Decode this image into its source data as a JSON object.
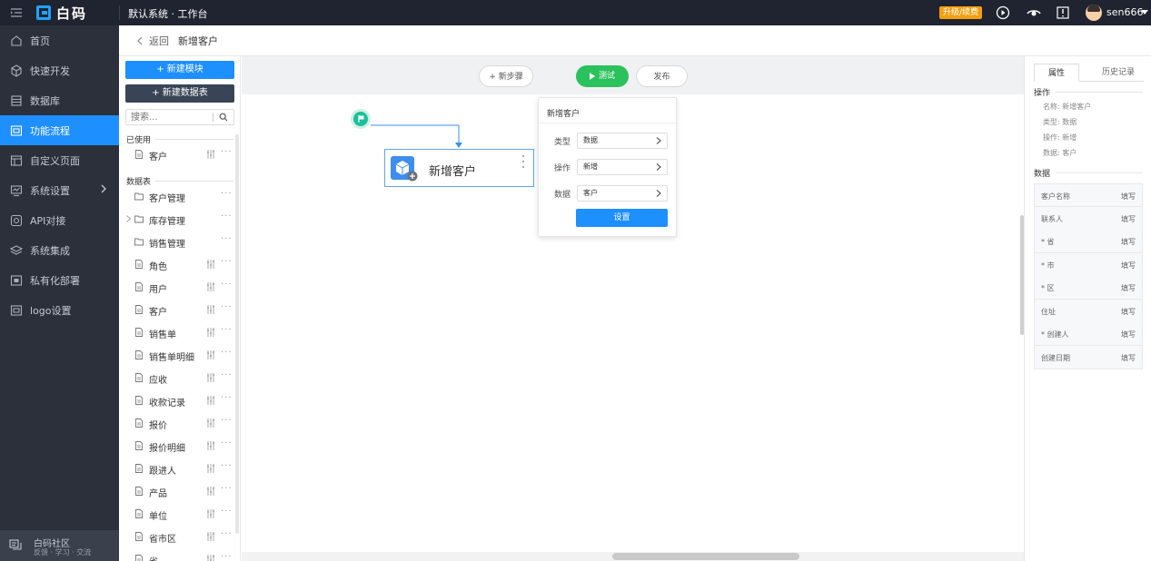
{
  "colors": {
    "topbar": "#1f2430",
    "sidebar": "#2b303b",
    "accent": "#1e8fff",
    "test_green": "#2bc15d",
    "upgrade": "#f4a012",
    "start_node": "#1bbf9c"
  },
  "topbar": {
    "logo_text": "白码",
    "workspace_title": "默认系统 · 工作台",
    "upgrade_label": "升级/续费",
    "username": "sen666"
  },
  "nav": {
    "items": [
      {
        "label": "首页",
        "icon": "home-icon"
      },
      {
        "label": "快速开发",
        "icon": "cube-icon"
      },
      {
        "label": "数据库",
        "icon": "database-icon"
      },
      {
        "label": "功能流程",
        "icon": "flow-icon",
        "active": true
      },
      {
        "label": "自定义页面",
        "icon": "page-icon"
      },
      {
        "label": "系统设置",
        "icon": "monitor-icon",
        "has_arrow": true
      },
      {
        "label": "API对接",
        "icon": "api-icon"
      },
      {
        "label": "系统集成",
        "icon": "layers-icon"
      },
      {
        "label": "私有化部署",
        "icon": "server-icon"
      },
      {
        "label": "logo设置",
        "icon": "logo-icon"
      }
    ],
    "community_title": "白码社区",
    "community_sub": "反馈 · 学习 · 交流"
  },
  "breadcrumb": {
    "back": "返回",
    "page": "新增客户"
  },
  "panel": {
    "new_module": "+ 新建模块",
    "new_table": "+ 新建数据表",
    "search_placeholder": "搜索...",
    "used_label": "已使用",
    "used_items": [
      {
        "label": "客户"
      }
    ],
    "tables_label": "数据表",
    "table_items": [
      {
        "label": "客户管理",
        "type": "folder"
      },
      {
        "label": "库存管理",
        "type": "folder",
        "expandable": true
      },
      {
        "label": "销售管理",
        "type": "folder"
      },
      {
        "label": "角色",
        "type": "table"
      },
      {
        "label": "用户",
        "type": "table"
      },
      {
        "label": "客户",
        "type": "table"
      },
      {
        "label": "销售单",
        "type": "table"
      },
      {
        "label": "销售单明细",
        "type": "table"
      },
      {
        "label": "应收",
        "type": "table"
      },
      {
        "label": "收款记录",
        "type": "table"
      },
      {
        "label": "报价",
        "type": "table"
      },
      {
        "label": "报价明细",
        "type": "table"
      },
      {
        "label": "跟进人",
        "type": "table"
      },
      {
        "label": "产品",
        "type": "table"
      },
      {
        "label": "单位",
        "type": "table"
      },
      {
        "label": "省市区",
        "type": "table"
      },
      {
        "label": "省",
        "type": "table"
      }
    ]
  },
  "canvas": {
    "new_step": "+ 新步骤",
    "test": "测试",
    "publish": "发布",
    "node_label": "新增客户",
    "popup": {
      "title": "新增客户",
      "rows": [
        {
          "label": "类型",
          "value": "数据"
        },
        {
          "label": "操作",
          "value": "新增"
        },
        {
          "label": "数据",
          "value": "客户"
        }
      ],
      "button": "设置"
    }
  },
  "right": {
    "tab_properties": "属性",
    "tab_history": "历史记录",
    "operation_label": "操作",
    "op_items": [
      "名称: 新增客户",
      "类型: 数据",
      "操作: 新增",
      "数据: 客户"
    ],
    "data_label": "数据",
    "fields": [
      {
        "name": "客户名称",
        "value": "填写"
      },
      {
        "name": "联系人",
        "value": "填写"
      },
      {
        "name": "* 省",
        "value": "填写"
      },
      {
        "name": "* 市",
        "value": "填写"
      },
      {
        "name": "* 区",
        "value": "填写"
      },
      {
        "name": "住址",
        "value": "填写"
      },
      {
        "name": "* 创建人",
        "value": "填写"
      },
      {
        "name": "创建日期",
        "value": "填写"
      }
    ]
  }
}
